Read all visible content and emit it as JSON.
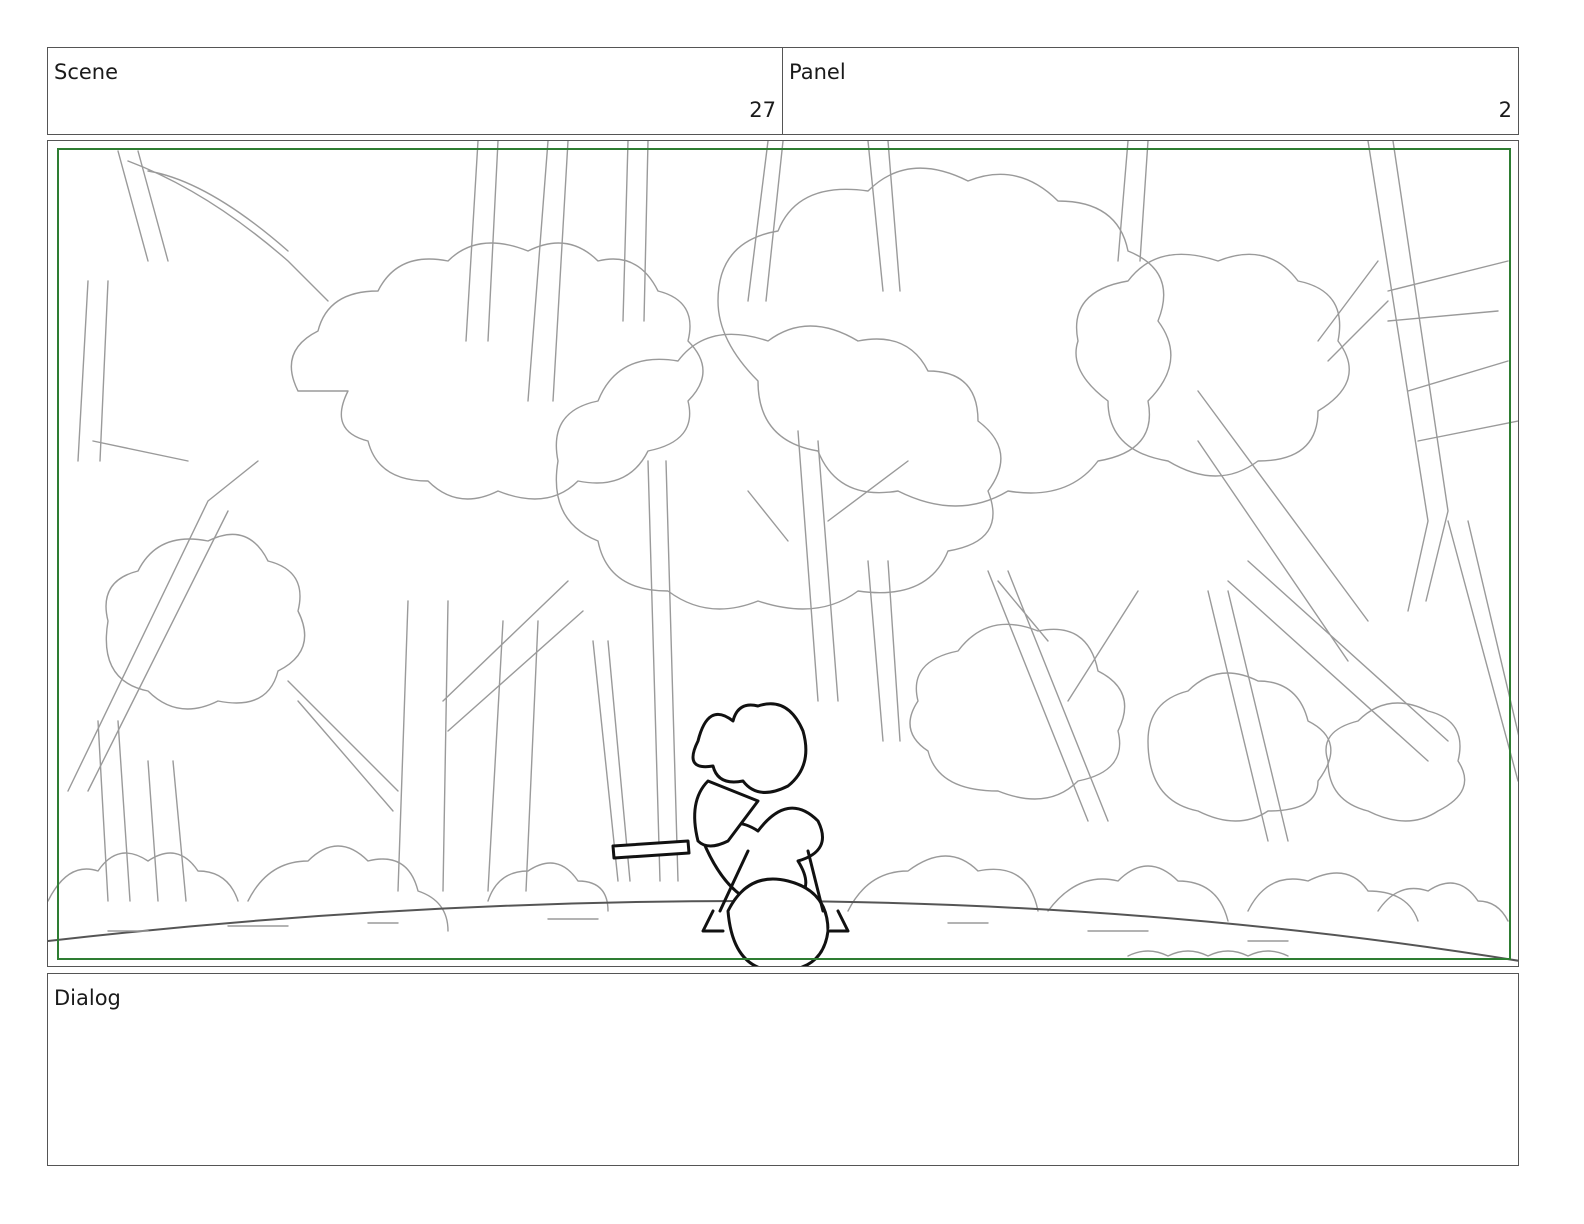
{
  "scene": {
    "label": "Scene",
    "number": "27"
  },
  "panel": {
    "label": "Panel",
    "number": "2"
  },
  "frame": {
    "safe_area_color": "#2e7d32",
    "illustration": "forest-scene-sketch"
  },
  "dialog": {
    "label": "Dialog",
    "text": ""
  }
}
